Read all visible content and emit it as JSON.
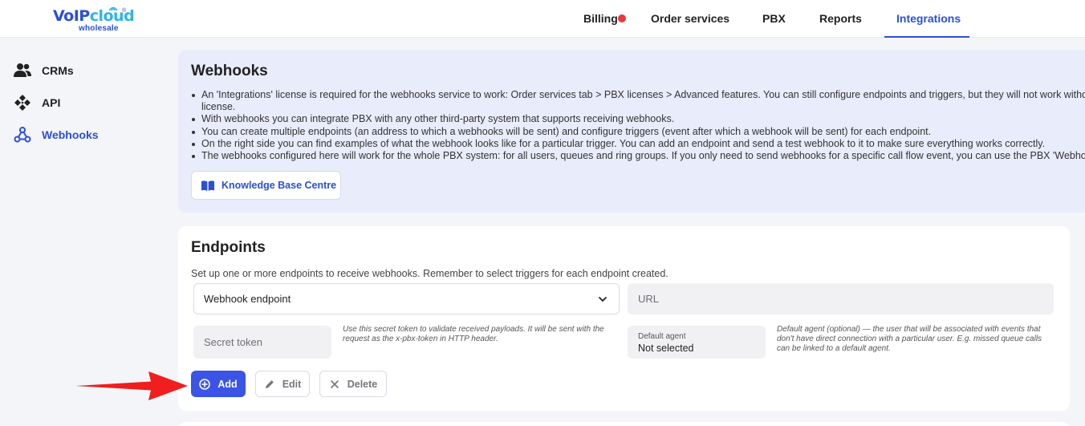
{
  "logo": {
    "brand_a": "VoIP",
    "brand_b": "cloud",
    "tm": "®",
    "sub": "wholesale"
  },
  "nav": {
    "billing": "Billing",
    "order_services": "Order services",
    "pbx": "PBX",
    "reports": "Reports",
    "integrations": "Integrations",
    "active": "Integrations",
    "alert_color": "#e8383d"
  },
  "sidebar": {
    "items": [
      {
        "label": "CRMs",
        "icon": "users-icon"
      },
      {
        "label": "API",
        "icon": "api-icon"
      },
      {
        "label": "Webhooks",
        "icon": "webhook-icon",
        "active": true
      }
    ]
  },
  "webhooks": {
    "title": "Webhooks",
    "bullets": [
      "An 'Integrations' license is required for the webhooks service to work: Order services tab > PBX licenses > Advanced features. You can still configure endpoints and triggers, but they will not work without a",
      "license.",
      "With webhooks you can integrate PBX with any other third-party system that supports receiving webhooks.",
      "You can create multiple endpoints (an address to which a webhooks will be sent) and configure triggers (event after which a webhook will be sent) for each endpoint.",
      "On the right side you can find examples of what the webhook looks like for a particular trigger. You can add an endpoint and send a test webhook to it to make sure everything works correctly.",
      "The webhooks configured here will work for the whole PBX system: for all users, queues and ring groups. If you only need to send webhooks for a specific call flow event, you can use the PBX 'Webhook' block"
    ],
    "kb_button": "Knowledge Base Centre"
  },
  "endpoints": {
    "title": "Endpoints",
    "description": "Set up one or more endpoints to receive webhooks. Remember to select triggers for each endpoint created.",
    "endpoint_select": "Webhook endpoint",
    "url_placeholder": "URL",
    "secret_placeholder": "Secret token",
    "secret_hint": "Use this secret token to validate received payloads. It will be sent with the request as the x-pbx-token in HTTP header.",
    "agent_caption": "Default agent",
    "agent_value": "Not selected",
    "agent_hint": "Default agent (optional) — the user that will be associated with events that don't have direct connection with a particular user. E.g. missed queue calls can be linked to a default agent.",
    "add_label": "Add",
    "edit_label": "Edit",
    "delete_label": "Delete"
  },
  "colors": {
    "accent": "#2a50d8",
    "primary_button": "#3b53e6",
    "info_panel": "#e9ecfb",
    "annotation_arrow": "#f01e1e"
  }
}
